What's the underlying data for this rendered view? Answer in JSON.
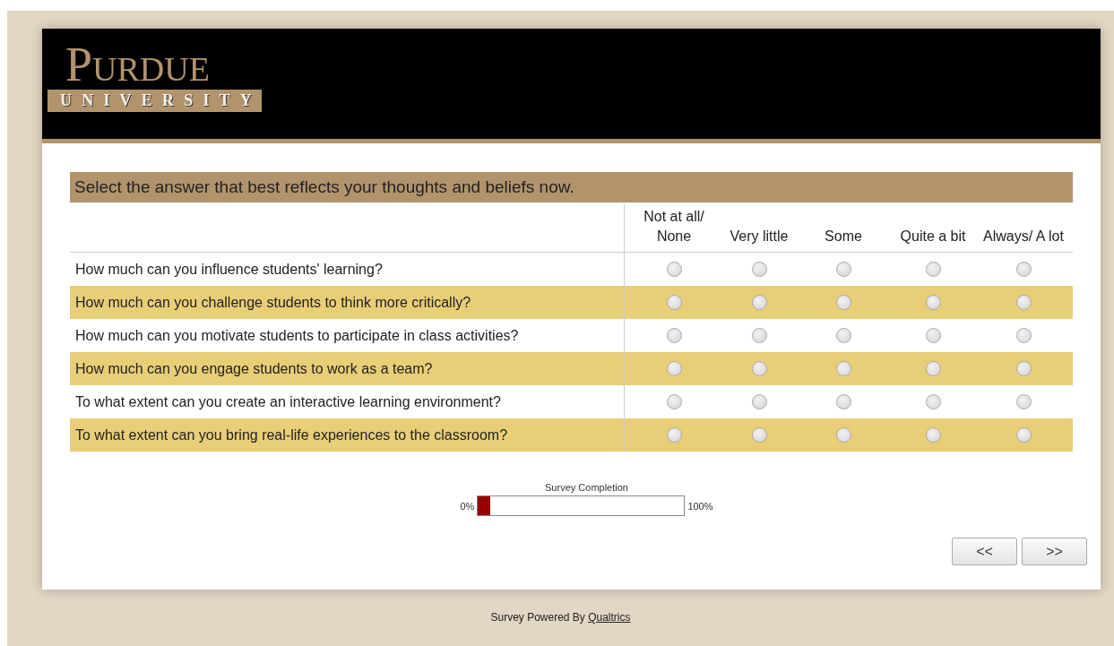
{
  "header": {
    "logo_title": "Purdue",
    "logo_subtitle": "UNIVERSITY"
  },
  "question": {
    "instruction": "Select the answer that best reflects your thoughts and beliefs now.",
    "columns": [
      "Not at all/ None",
      "Very little",
      "Some",
      "Quite a bit",
      "Always/ A lot"
    ],
    "rows": [
      {
        "text": "How much can you influence students' learning?",
        "options": [
          {
            "selected": false
          },
          {
            "selected": false
          },
          {
            "selected": false
          },
          {
            "selected": false
          },
          {
            "selected": false
          }
        ]
      },
      {
        "text": "How much can you challenge students to think more critically?",
        "options": [
          {
            "selected": false
          },
          {
            "selected": false
          },
          {
            "selected": false
          },
          {
            "selected": false
          },
          {
            "selected": false
          }
        ]
      },
      {
        "text": "How much can you motivate students to participate in class activities?",
        "options": [
          {
            "selected": false
          },
          {
            "selected": false
          },
          {
            "selected": false
          },
          {
            "selected": false
          },
          {
            "selected": false
          }
        ]
      },
      {
        "text": "How much can you engage students to work as a team?",
        "options": [
          {
            "selected": false
          },
          {
            "selected": false
          },
          {
            "selected": false
          },
          {
            "selected": false
          },
          {
            "selected": false
          }
        ]
      },
      {
        "text": "To what extent can you create an interactive learning environment?",
        "options": [
          {
            "selected": false
          },
          {
            "selected": false
          },
          {
            "selected": false
          },
          {
            "selected": false
          },
          {
            "selected": false
          }
        ]
      },
      {
        "text": "To what extent can you bring real-life experiences to the classroom?",
        "options": [
          {
            "selected": false
          },
          {
            "selected": false
          },
          {
            "selected": false
          },
          {
            "selected": false
          },
          {
            "selected": false
          }
        ]
      }
    ]
  },
  "progress": {
    "label": "Survey Completion",
    "min_label": "0%",
    "max_label": "100%",
    "level": 0.06
  },
  "buttons": [
    "<<",
    ">>"
  ],
  "footer": {
    "text": "Survey Powered By",
    "link": "Qualtrics"
  }
}
